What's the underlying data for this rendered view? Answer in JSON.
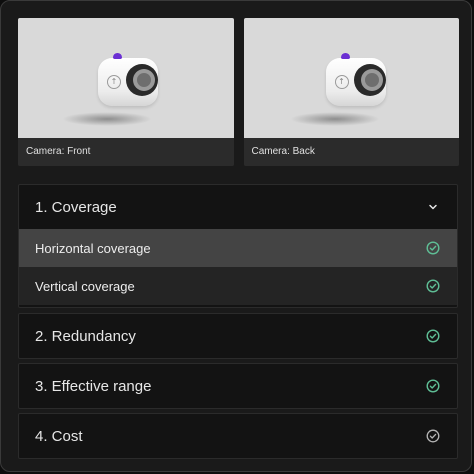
{
  "views": [
    {
      "caption": "Camera: Front",
      "badge_glyph": "↑"
    },
    {
      "caption": "Camera: Back",
      "badge_glyph": "↑"
    }
  ],
  "sections": [
    {
      "label": "1. Coverage",
      "expanded": true,
      "icon": "chevron-down-icon",
      "items": [
        {
          "label": "Horizontal coverage",
          "selected": true,
          "icon": "check-circle-icon"
        },
        {
          "label": "Vertical coverage",
          "selected": false,
          "icon": "check-circle-icon"
        }
      ]
    },
    {
      "label": "2. Redundancy",
      "icon": "check-circle-icon"
    },
    {
      "label": "3. Effective range",
      "icon": "check-circle-icon"
    },
    {
      "label": "4. Cost",
      "icon": "check-circle-outline-icon"
    }
  ],
  "colors": {
    "check": "#5fbf96",
    "check_muted": "#b5b5b5",
    "accent_purple": "#6b2fd3"
  }
}
